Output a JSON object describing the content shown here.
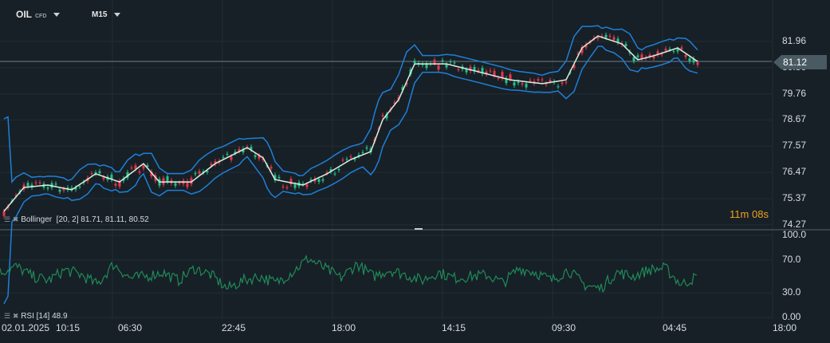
{
  "header": {
    "symbol": "OIL",
    "symbol_type": "CFD",
    "timeframe": "M15"
  },
  "price_axis": [
    "81.96",
    "80.86",
    "79.76",
    "78.67",
    "77.57",
    "76.47",
    "75.37",
    "74.27"
  ],
  "current_price": "81.12",
  "countdown": {
    "minutes": "11",
    "m": "m",
    "seconds": "08",
    "s": "s"
  },
  "bollinger": {
    "label": "Bollinger",
    "params": "[20, 2]",
    "values": "81.71,  81.11,  80.52"
  },
  "rsi": {
    "label": "RSI",
    "params": "[14]",
    "value": "48.9"
  },
  "rsi_axis": [
    "100.0",
    "70.0",
    "30.0",
    "0.00"
  ],
  "time_axis": [
    "02.01.2025",
    "10:15",
    "06:30",
    "22:45",
    "18:00",
    "14:15",
    "09:30",
    "04:45",
    "18:00"
  ],
  "colors": {
    "bg": "#172026",
    "band": "#1e7fd9",
    "mid": "#d8efe0",
    "up": "#26c089",
    "down": "#e8364f",
    "rsi": "#1f8a5a"
  },
  "chart_data": {
    "type": "line",
    "title": "OIL CFD M15",
    "x_unit": "bar index",
    "price_series": [
      [
        1,
        74.84
      ],
      [
        6,
        75.84
      ],
      [
        12,
        75.94
      ],
      [
        18,
        75.74
      ],
      [
        24,
        76.41
      ],
      [
        30,
        76.07
      ],
      [
        36,
        76.84
      ],
      [
        40,
        76.07
      ],
      [
        48,
        76.07
      ],
      [
        54,
        76.84
      ],
      [
        62,
        77.51
      ],
      [
        66,
        77.08
      ],
      [
        69,
        76.17
      ],
      [
        76,
        75.94
      ],
      [
        82,
        76.41
      ],
      [
        88,
        77.01
      ],
      [
        93,
        77.34
      ],
      [
        96,
        78.68
      ],
      [
        100,
        79.52
      ],
      [
        104,
        81.02
      ],
      [
        112,
        81.02
      ],
      [
        120,
        80.69
      ],
      [
        128,
        80.35
      ],
      [
        136,
        80.19
      ],
      [
        142,
        80.35
      ],
      [
        146,
        81.69
      ],
      [
        150,
        82.19
      ],
      [
        156,
        81.86
      ],
      [
        160,
        81.19
      ],
      [
        164,
        81.36
      ],
      [
        170,
        81.69
      ],
      [
        175,
        81.12
      ]
    ],
    "ylim": [
      74.27,
      82.6
    ],
    "rsi_values": [
      55,
      62,
      50,
      45,
      58,
      52,
      40,
      65,
      48,
      50,
      55,
      45,
      60,
      52,
      35,
      45,
      50,
      42,
      55,
      72,
      60,
      48,
      65,
      50,
      58,
      52,
      45,
      55,
      48,
      50,
      52,
      42,
      60,
      55,
      45,
      58,
      40,
      35,
      55,
      50,
      58,
      60,
      40,
      50
    ],
    "rsi_ylim": [
      0,
      100
    ]
  }
}
